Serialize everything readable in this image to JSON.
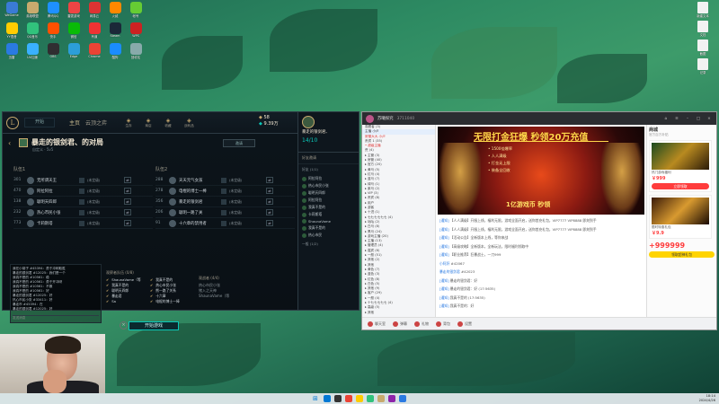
{
  "desktop": {
    "icons": [
      {
        "label": "WeGame",
        "color": "#3a7bd5"
      },
      {
        "label": "英雄联盟",
        "color": "#c8aa6e"
      },
      {
        "label": "腾讯QQ",
        "color": "#1e90ff"
      },
      {
        "label": "雷霆游戏",
        "color": "#e44"
      },
      {
        "label": "网易云",
        "color": "#d33"
      },
      {
        "label": "火绒",
        "color": "#f80"
      },
      {
        "label": "帐号",
        "color": "#6c3"
      },
      {
        "label": "YY语音",
        "color": "#ffcc00"
      },
      {
        "label": "QQ音乐",
        "color": "#31c27c"
      },
      {
        "label": "快手",
        "color": "#ff5000"
      },
      {
        "label": "微信",
        "color": "#09bb07"
      },
      {
        "label": "有道",
        "color": "#e33"
      },
      {
        "label": "Steam",
        "color": "#1b2838"
      },
      {
        "label": "WPS",
        "color": "#c22"
      },
      {
        "label": "迅雷",
        "color": "#2a7ae2"
      },
      {
        "label": "UU加速",
        "color": "#3ab0ff"
      },
      {
        "label": "OBS",
        "color": "#302e31"
      },
      {
        "label": "Edge",
        "color": "#2c9ed9"
      },
      {
        "label": "Chrome",
        "color": "#ea4335"
      },
      {
        "label": "酷狗",
        "color": "#1a8cff"
      },
      {
        "label": "回收站",
        "color": "#8aa"
      }
    ],
    "right_icons": [
      {
        "label": "新建文本"
      },
      {
        "label": "文档"
      },
      {
        "label": "截图"
      },
      {
        "label": "记录"
      }
    ]
  },
  "lol": {
    "logo": "L",
    "play": "开始",
    "nav_home": "主页",
    "nav_clash": "云顶之弈",
    "top_icons": [
      "生存",
      "商店",
      "收藏",
      "战利品"
    ],
    "currency_be": "58",
    "currency_rp": "9.39万",
    "back": "‹",
    "title": "暴走的银剑君、的对局",
    "subtitle": "自定义 · 5v5",
    "invite_btn": "邀请",
    "team1": {
      "label": "队伍1",
      "players": [
        {
          "lv": "301",
          "name": "无所谓天王",
          "rank": "(未定级)"
        },
        {
          "lv": "470",
          "name": "阿拉阿拉",
          "rank": "(未定级)"
        },
        {
          "lv": "138",
          "name": "聪明天四郎",
          "rank": "(未定级)"
        },
        {
          "lv": "232",
          "name": "热心市民小张",
          "rank": "(未定级)"
        },
        {
          "lv": "773",
          "name": "卡莉斯塔",
          "rank": "(未定级)"
        }
      ]
    },
    "team2": {
      "label": "队伍2",
      "players": [
        {
          "lv": "288",
          "name": "天天元气女孩",
          "rank": "(未定级)"
        },
        {
          "lv": "278",
          "name": "电棍的博士一棒",
          "rank": "(未定级)"
        },
        {
          "lv": "356",
          "name": "暴走的银剑君",
          "rank": "(未定级)"
        },
        {
          "lv": "206",
          "name": "聪明一路了关",
          "rank": "(未定级)"
        },
        {
          "lv": "91",
          "name": "十六章的禁用者",
          "rank": "(未定级)"
        }
      ]
    },
    "chat": [
      "我在小胡子 #45394：勇于冲刺取胜",
      "暴走的银剑君 #12025：我们是一个",
      "我真不是的 #10561：稳",
      "我真不是的 #10561：勇于开冲呀",
      "我真不是的 #10561：不服",
      "我真不是的 #10561：好",
      "暴走的银剑君 #12025：好",
      "热心市民小张 #33411：好",
      "暴走市 #45394：在",
      "暴走的银剑君 #12025：好"
    ],
    "chat_input": "发送消息",
    "bots_header": "观察者队伍 (0/8)",
    "bots": [
      {
        "a": "ShaunaVame（等",
        "b": "我真不是的"
      },
      {
        "a": "我真不是的",
        "b": "热心市民小张"
      },
      {
        "a": "聪明天四郎",
        "b": "熊一路了关系"
      },
      {
        "a": "暴走君",
        "b": "十六章"
      },
      {
        "a": "Sa",
        "b": "电棍的博士一棒"
      }
    ],
    "pos_header": "观战者 (4/4)",
    "pos_rows": [
      "热心市民小张",
      "猪入之天神",
      "ShaunaVame（等"
    ],
    "start_btn": "开始游戏",
    "close": "×",
    "social": {
      "name": "暴走的银剑君、",
      "level": "14/10",
      "header": "好友邀请",
      "groups": [
        "好友 (1/1)",
        "一般 (1/2)"
      ],
      "friends": [
        "阿拉阿拉",
        "热心市民小张",
        "聪明天四郎",
        "阿拉阿拉",
        "我真不是的",
        "卡莉斯塔",
        "ShaunaVame",
        "我真不是的",
        "热心市民"
      ]
    }
  },
  "stream": {
    "top_title": "苏曦探究",
    "top_id": "3711040",
    "left_rows": [
      {
        "t": "观看者 (3)",
        "c": "n"
      },
      {
        "t": "主播 小卢",
        "c": "hl"
      },
      {
        "t": "房管大大 小卢",
        "c": "red"
      },
      {
        "t": "贵宾 1 (35)",
        "c": "n"
      },
      {
        "t": "• 超级主播",
        "c": "red"
      },
      {
        "t": "    荒 (4)",
        "c": "n"
      },
      {
        "t": "  ▸ 主管 (3)",
        "c": "n"
      },
      {
        "t": "  ▸ 房管 (40)",
        "c": "n"
      },
      {
        "t": "  ▸ 官方 (20)",
        "c": "n"
      },
      {
        "t": "  ▸ 黄马 (5)",
        "c": "n"
      },
      {
        "t": "  ▸ 红马 (4)",
        "c": "n"
      },
      {
        "t": "  ▸ 蓝马 (7)",
        "c": "n"
      },
      {
        "t": "  ▸ 绿马 (1)",
        "c": "n"
      },
      {
        "t": "  ▸ 紫马 (2)",
        "c": "n"
      },
      {
        "t": "  ▸ VIP (3)",
        "c": "n"
      },
      {
        "t": "  ▸ 贵宾 (8)",
        "c": "n"
      },
      {
        "t": "  ▸ 用户",
        "c": "n"
      },
      {
        "t": "  ▸ 游客",
        "c": "n"
      },
      {
        "t": "  ▸ 十进 (1)",
        "c": "n"
      },
      {
        "t": "  ▸ 七七七七七七 (4)",
        "c": "n"
      },
      {
        "t": "  ▸ 咕咕 (2)",
        "c": "n"
      },
      {
        "t": "  ▸ 白马 (8)",
        "c": "n"
      },
      {
        "t": "  ▸ 黑马 (24)",
        "c": "n"
      },
      {
        "t": "  ▸ 游戏主播 (20)",
        "c": "n"
      },
      {
        "t": "  ▸ 主播 (13)",
        "c": "n"
      },
      {
        "t": "  ▸ 管理员 (4)",
        "c": "n"
      },
      {
        "t": "  ▸ 嘉宾 (6)",
        "c": "n"
      },
      {
        "t": "  ▸ 一般 (51)",
        "c": "n"
      },
      {
        "t": "  ▸ 其他 (2)",
        "c": "n"
      },
      {
        "t": "  ▸ 其他",
        "c": "n"
      },
      {
        "t": "  ▸ 黄色 (7)",
        "c": "n"
      },
      {
        "t": "  ▸ 蓝色 (3)",
        "c": "n"
      },
      {
        "t": "  ▸ 红色 (8)",
        "c": "n"
      },
      {
        "t": "  ▸ 白色 (5)",
        "c": "n"
      },
      {
        "t": "  ▸ 其他 (9)",
        "c": "n"
      },
      {
        "t": "  ▸ 客户 (29)",
        "c": "n"
      },
      {
        "t": "  ▸ 一般 (4)",
        "c": "n"
      },
      {
        "t": "  ▸ 十七七七七七 (4)",
        "c": "n"
      },
      {
        "t": "  ▸ 高级 (5)",
        "c": "n"
      },
      {
        "t": "  ▸ 其他",
        "c": "n"
      }
    ],
    "banner": {
      "title": "无限打金狂爆 秒领20万充值",
      "lines": [
        "• 1500倍爆率",
        "• 人人满级",
        "• 打金无上限",
        "• 装备全回收"
      ],
      "big": "1亿游戏币 秒领"
    },
    "messages": [
      {
        "n": "[通知]",
        "t": "【人人满级】开服上线，福利无限，游戏全面开启，送你首充礼包，VIP7777 VIP8888 即刻到手"
      },
      {
        "n": "[通知]",
        "t": "【人人满级】开服上线，福利无限，游戏全面开启，送你首充礼包，VIP7777 VIP8888 即刻到手"
      },
      {
        "n": "[通知]",
        "t": "【活动公告】全新版本上线，等你来战"
      },
      {
        "n": "[通知]",
        "t": "【高级攻略】全新版本，全新玩法，限时福利领取中"
      },
      {
        "n": "[通知]",
        "t": "【职业推荐】狂暴战士，一刀999"
      },
      {
        "n": "小阿肝",
        "t": "#42067"
      },
      {
        "n": "暴走的银剑君",
        "t": "#42023"
      },
      {
        "n": "[通知]",
        "t": "暴走的银剑君：好"
      },
      {
        "n": "[通知]",
        "t": "暴走的银剑君：好 (17:5635)"
      },
      {
        "n": "[通知]",
        "t": "我真不是的 (17:5635)"
      },
      {
        "n": "[通知]",
        "t": "我真不是的：好"
      }
    ],
    "input_placeholder": "说点什么吧...",
    "shop": {
      "title": "商城",
      "subtitle": "官方百万补贴",
      "card1_title": "热门游戏福利",
      "card1_price": "￥999",
      "card1_btn": "立即领取",
      "card2_title": "限时特惠礼包",
      "card2_price": "￥9.9",
      "big_price": "+999999",
      "buy_btn": "领取超神礼包"
    },
    "bottom": [
      "聊天室",
      "弹幕",
      "礼物",
      "背包",
      "设置"
    ]
  },
  "taskbar": {
    "time": "18:14",
    "date": "2024/4/26",
    "apps": [
      "#0078d4",
      "#333",
      "#ea4335",
      "#ffcc00",
      "#31c27c",
      "#c8aa6e",
      "#8e24aa",
      "#2a7ae2"
    ]
  }
}
